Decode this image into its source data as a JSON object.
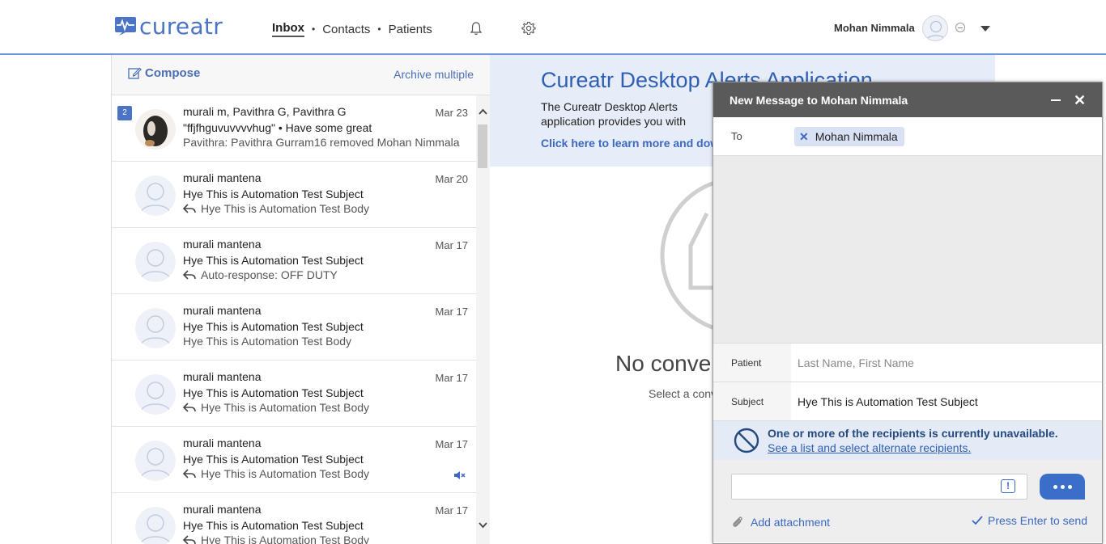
{
  "app": {
    "logo_text": "cureatr",
    "nav": {
      "inbox": "Inbox",
      "contacts": "Contacts",
      "patients": "Patients",
      "separator": "•"
    },
    "user_name": "Mohan Nimmala"
  },
  "left": {
    "compose_label": "Compose",
    "archive_label": "Archive multiple",
    "conversations": [
      {
        "badge": "2",
        "name": "murali m, Pavithra G, Pavithra G",
        "date": "Mar 23",
        "subject": "\"ffjfhguvuvvvvhug\" • Have some great",
        "body": "Pavithra: Pavithra Gurram16 removed Mohan Nimmala",
        "has_reply_icon": false,
        "muted": false,
        "avatar": "photo"
      },
      {
        "badge": "",
        "name": "murali mantena",
        "date": "Mar 20",
        "subject": "Hye This is Automation Test Subject",
        "body": "Hye This is Automation Test Body",
        "has_reply_icon": true,
        "muted": false,
        "avatar": "default"
      },
      {
        "badge": "",
        "name": "murali mantena",
        "date": "Mar 17",
        "subject": "Hye This is Automation Test Subject",
        "body": "Auto-response: OFF DUTY",
        "has_reply_icon": true,
        "muted": false,
        "avatar": "default"
      },
      {
        "badge": "",
        "name": "murali mantena",
        "date": "Mar 17",
        "subject": "Hye This is Automation Test Subject",
        "body": "Hye This is Automation Test Body",
        "has_reply_icon": false,
        "muted": false,
        "avatar": "default"
      },
      {
        "badge": "",
        "name": "murali mantena",
        "date": "Mar 17",
        "subject": "Hye This is Automation Test Subject",
        "body": "Hye This is Automation Test Body",
        "has_reply_icon": true,
        "muted": false,
        "avatar": "default"
      },
      {
        "badge": "",
        "name": "murali mantena",
        "date": "Mar 17",
        "subject": "Hye This is Automation Test Subject",
        "body": "Hye This is Automation Test Body",
        "has_reply_icon": true,
        "muted": true,
        "avatar": "default"
      },
      {
        "badge": "",
        "name": "murali mantena",
        "date": "Mar 17",
        "subject": "Hye This is Automation Test Subject",
        "body": "Hye This is Automation Test Body",
        "has_reply_icon": true,
        "muted": false,
        "avatar": "default"
      }
    ]
  },
  "right": {
    "alert_title": "Cureatr Desktop Alerts Application",
    "alert_text": "The Cureatr Desktop Alerts application provides you with events notifications on your computer.",
    "alert_link": "Click here to learn more and download",
    "empty_title": "No conversation selected",
    "empty_sub": "Select a conversation"
  },
  "modal": {
    "title": "New Message to Mohan Nimmala",
    "to_label": "To",
    "recipient": "Mohan Nimmala",
    "patient_label": "Patient",
    "patient_placeholder": "Last Name, First Name",
    "subject_label": "Subject",
    "subject_value": "Hye This is Automation Test Subject",
    "warning_line1": "One or more of the recipients is currently unavailable.",
    "warning_line2": "See a list and select alternate recipients.",
    "urgent_symbol": "!",
    "attach_label": "Add attachment",
    "press_enter_label": "Press Enter to send"
  },
  "colors": {
    "brand": "#4b74c6",
    "link": "#3b68c0",
    "header_dark": "#5a5a5a",
    "banner": "#e6ecf8"
  },
  "icons": [
    "logo-icon",
    "bell-icon",
    "gear-icon",
    "compose-icon",
    "reply-icon",
    "mute-icon",
    "close-icon",
    "minimize-icon",
    "block-icon",
    "urgent-icon",
    "paperclip-icon",
    "checkmark-icon"
  ]
}
